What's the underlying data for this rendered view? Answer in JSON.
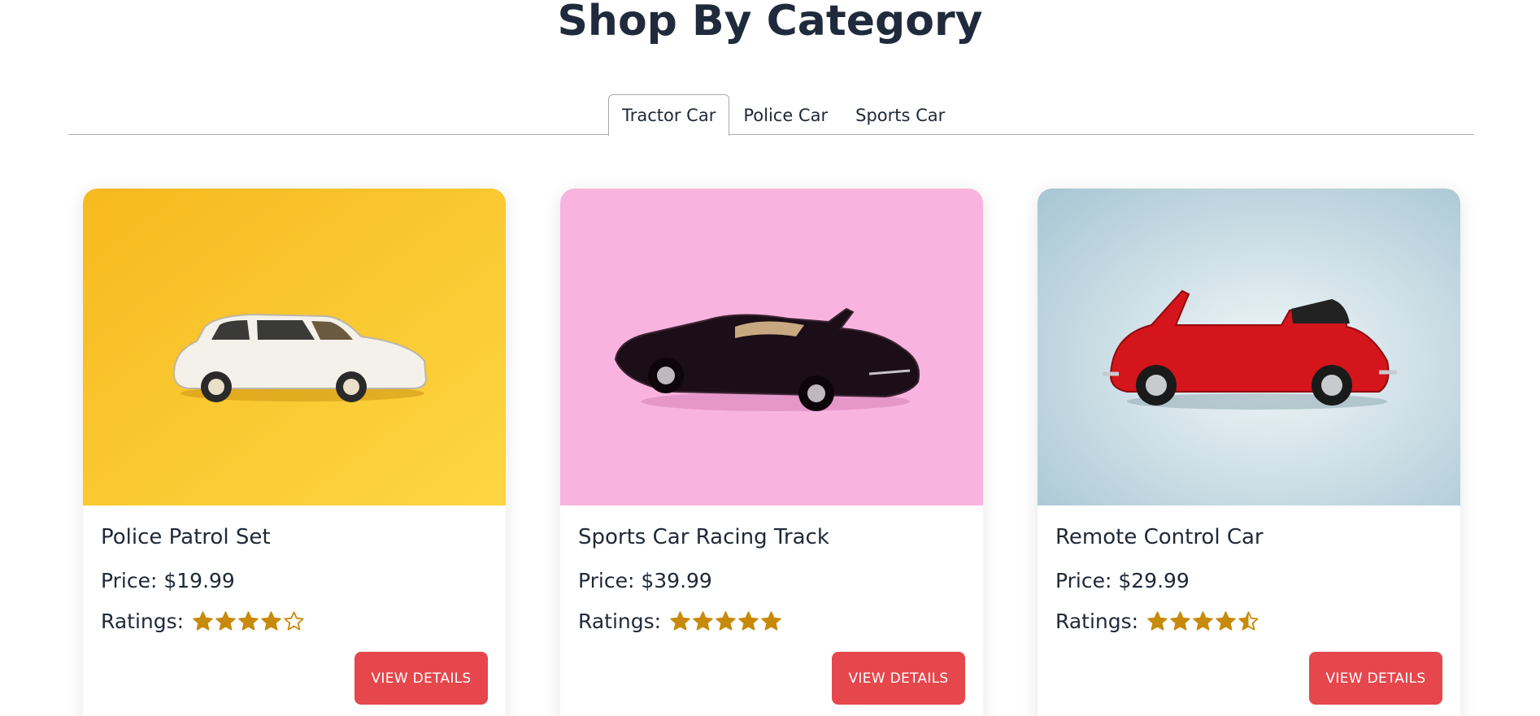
{
  "page": {
    "title": "Shop By Category"
  },
  "tabs": [
    {
      "label": "Tractor Car",
      "active": true
    },
    {
      "label": "Police Car",
      "active": false
    },
    {
      "label": "Sports Car",
      "active": false
    }
  ],
  "products": [
    {
      "name": "Police Patrol Set",
      "price": "Price: $19.99",
      "ratings_label": "Ratings:",
      "rating": 4,
      "button_label": "VIEW DETAILS",
      "image_bg": "#f9c22e",
      "car_color": "#f4f1ea"
    },
    {
      "name": "Sports Car Racing Track",
      "price": "Price: $39.99",
      "ratings_label": "Ratings:",
      "rating": 5,
      "button_label": "VIEW DETAILS",
      "image_bg": "#f8b4df",
      "car_color": "#1c0e18"
    },
    {
      "name": "Remote Control Car",
      "price": "Price: $29.99",
      "ratings_label": "Ratings:",
      "rating": 4.5,
      "button_label": "VIEW DETAILS",
      "image_bg": "#cfe0e8",
      "car_color": "#d4151b"
    }
  ],
  "colors": {
    "accent_button": "#e5474c",
    "star": "#c88a0a",
    "title": "#1f2a3c"
  },
  "icons": {
    "star_full": "star-filled-icon",
    "star_half": "star-half-icon",
    "star_empty": "star-outline-icon"
  }
}
